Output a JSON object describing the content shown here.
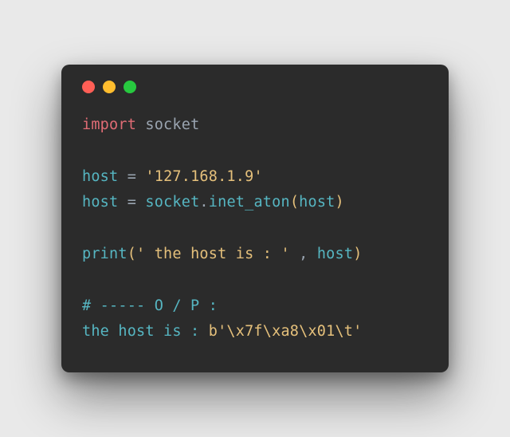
{
  "traffic": {
    "red": "#ff5f56",
    "yellow": "#ffbd2e",
    "green": "#27c93f"
  },
  "code": {
    "l1": {
      "kw": "import",
      "mod": "socket"
    },
    "blank1": "",
    "l2": {
      "lhs": "host",
      "eq": "=",
      "str": "'127.168.1.9'"
    },
    "l3": {
      "lhs": "host",
      "eq": "=",
      "mod": "socket",
      "dot": ".",
      "fn": "inet_aton",
      "lp": "(",
      "arg": "host",
      "rp": ")"
    },
    "blank2": "",
    "l4": {
      "fn": "print",
      "lp": "(",
      "str": "' the host is : '",
      "comma": " ,",
      "arg": " host",
      "rp": ")"
    },
    "blank3": "",
    "l5": {
      "comment": "# ----- O / P :"
    },
    "l6": {
      "lead": "the host is : ",
      "pre": "b",
      "bytes": "'\\x7f\\xa8\\x01\\t'"
    }
  }
}
